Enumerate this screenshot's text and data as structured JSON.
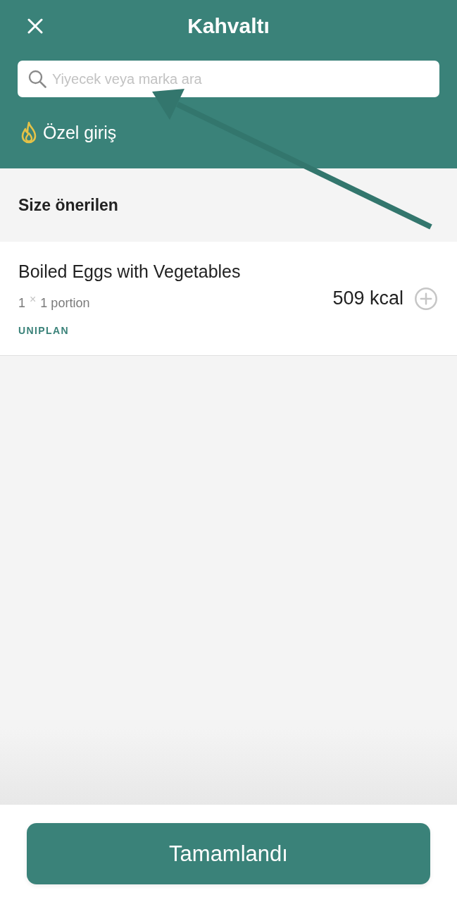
{
  "header": {
    "title": "Kahvaltı"
  },
  "search": {
    "placeholder": "Yiyecek veya marka ara"
  },
  "custom_entry": {
    "label": "Özel giriş"
  },
  "section": {
    "title": "Size önerilen"
  },
  "items": [
    {
      "name": "Boiled Eggs with Vegetables",
      "serving": "1 $^{×}$ 1 portion",
      "source": "UNIPLAN",
      "calories": "509 kcal"
    }
  ],
  "footer": {
    "button": "Tamamlandı"
  }
}
